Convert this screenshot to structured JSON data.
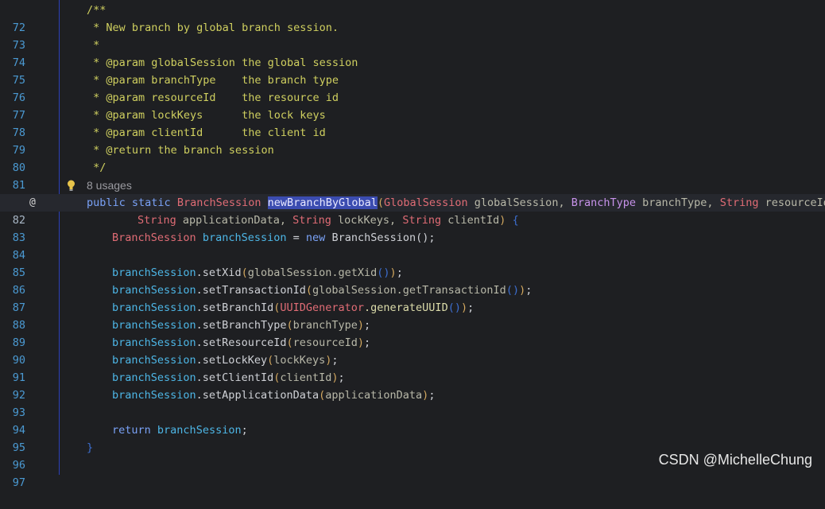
{
  "editor": {
    "line_numbers": [
      "72",
      "73",
      "74",
      "75",
      "76",
      "77",
      "78",
      "79",
      "80",
      "81",
      "82",
      "83",
      "84",
      "85",
      "86",
      "87",
      "88",
      "89",
      "90",
      "91",
      "92",
      "93",
      "94",
      "95",
      "96",
      "97"
    ],
    "current_line": "82",
    "gutter_icon": "@",
    "inlay_hint": "8 usages",
    "code": {
      "l72": "/**",
      "l73": " * New branch by global branch session.",
      "l74": " *",
      "l75": " * @param globalSession the global session",
      "l76": " * @param branchType    the branch type",
      "l77": " * @param resourceId    the resource id",
      "l78": " * @param lockKeys      the lock keys",
      "l79": " * @param clientId      the client id",
      "l80": " * @return the branch session",
      "l81": " */",
      "l82": {
        "kw1": "public",
        "kw2": "static",
        "ret": "BranchSession",
        "name": "newBranchByGlobal",
        "open": "(",
        "t1": "GlobalSession",
        "p1": "globalSession,",
        "t2": "BranchType",
        "p2": "branchType,",
        "t3": "String",
        "p3": "resourceId,"
      },
      "l83": {
        "t4": "String",
        "p4": "applicationData,",
        "t5": "String",
        "p5": "lockKeys,",
        "t6": "String",
        "p6": "clientId",
        "close": ")",
        "brace": "{"
      },
      "l84": {
        "type": "BranchSession",
        "var": "branchSession",
        "eq": "=",
        "kw": "new",
        "ctor": "BranchSession",
        "args": "();"
      },
      "l86": {
        "obj": "branchSession",
        "call": ".setXid",
        "o": "(",
        "arg": "globalSession.getXid",
        "inner": "()",
        "c": ")",
        "end": ";"
      },
      "l87": {
        "obj": "branchSession",
        "call": ".setTransactionId",
        "o": "(",
        "arg": "globalSession.getTransactionId",
        "inner": "()",
        "c": ")",
        "end": ";"
      },
      "l88": {
        "obj": "branchSession",
        "call": ".setBranchId",
        "o": "(",
        "cls": "UUIDGenerator",
        "arg": ".generateUUID",
        "inner": "()",
        "c": ")",
        "end": ";"
      },
      "l89": {
        "obj": "branchSession",
        "call": ".setBranchType",
        "o": "(",
        "arg": "branchType",
        "c": ")",
        "end": ";"
      },
      "l90": {
        "obj": "branchSession",
        "call": ".setResourceId",
        "o": "(",
        "arg": "resourceId",
        "c": ")",
        "end": ";"
      },
      "l91": {
        "obj": "branchSession",
        "call": ".setLockKey",
        "o": "(",
        "arg": "lockKeys",
        "c": ")",
        "end": ";"
      },
      "l92": {
        "obj": "branchSession",
        "call": ".setClientId",
        "o": "(",
        "arg": "clientId",
        "c": ")",
        "end": ";"
      },
      "l93": {
        "obj": "branchSession",
        "call": ".setApplicationData",
        "o": "(",
        "arg": "applicationData",
        "c": ")",
        "end": ";"
      },
      "l95": {
        "kw": "return",
        "var": "branchSession",
        "end": ";"
      },
      "l96": "}"
    }
  },
  "watermark": "CSDN @MichelleChung",
  "colors": {
    "background": "#1e1f22",
    "doc_comment": "#cfcf5f",
    "keyword": "#7aa2f7",
    "type": "#e06c75",
    "variable": "#4db6e6",
    "selection": "#3b4cb0",
    "line_number": "#4b9ad3"
  }
}
